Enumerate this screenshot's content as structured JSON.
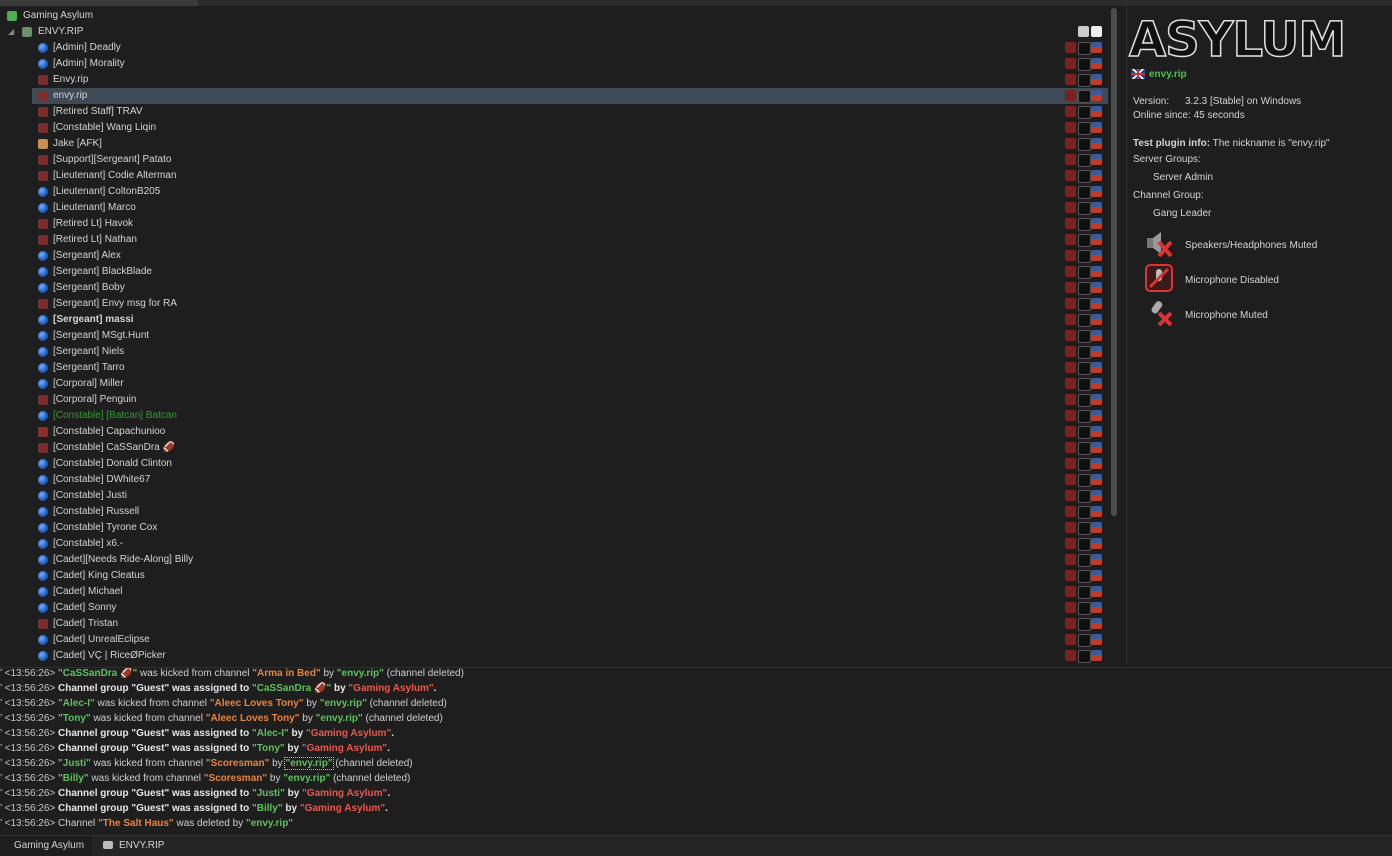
{
  "tree": {
    "server_name": "Gaming Asylum",
    "channel_name": "ENVY.RIP",
    "users": [
      {
        "name": "[Admin] Deadly",
        "kind": "blue"
      },
      {
        "name": "[Admin] Morality",
        "kind": "blue"
      },
      {
        "name": "Envy.rip",
        "kind": "dev"
      },
      {
        "name": "envy.rip",
        "kind": "dev",
        "selected": true
      },
      {
        "name": "[Retired Staff] TRAV",
        "kind": "dev"
      },
      {
        "name": "[Constable] Wang Liqin",
        "kind": "dev"
      },
      {
        "name": "Jake [AFK]",
        "kind": "away"
      },
      {
        "name": "[Support][Sergeant] Patato",
        "kind": "dev"
      },
      {
        "name": "[Lieutenant] Codie Alterman",
        "kind": "dev"
      },
      {
        "name": "[Lieutenant] ColtonB205",
        "kind": "blue"
      },
      {
        "name": "[Lieutenant] Marco",
        "kind": "blue"
      },
      {
        "name": "[Retired Lt] Havok",
        "kind": "dev"
      },
      {
        "name": "[Retired Lt] Nathan",
        "kind": "dev"
      },
      {
        "name": "[Sergeant] Alex",
        "kind": "blue"
      },
      {
        "name": "[Sergeant] BlackBlade",
        "kind": "blue"
      },
      {
        "name": "[Sergeant] Boby",
        "kind": "blue"
      },
      {
        "name": "[Sergeant] Envy msg for RA",
        "kind": "dev"
      },
      {
        "name": "[Sergeant] massi",
        "kind": "blue",
        "bold": true
      },
      {
        "name": "[Sergeant] MSgt.Hunt",
        "kind": "blue"
      },
      {
        "name": "[Sergeant] Niels",
        "kind": "blue"
      },
      {
        "name": "[Sergeant] Tarro",
        "kind": "blue"
      },
      {
        "name": "[Corporal] Miller",
        "kind": "blue"
      },
      {
        "name": "[Corporal] Penguin",
        "kind": "dev"
      },
      {
        "name": "[Constable] [Batcan] Batcan",
        "kind": "blue",
        "green": true
      },
      {
        "name": "[Constable] Capachunioo",
        "kind": "muted"
      },
      {
        "name": "[Constable] CaSSanDra 🏈",
        "kind": "dev"
      },
      {
        "name": "[Constable] Donald Clinton",
        "kind": "blue"
      },
      {
        "name": "[Constable] DWhite67",
        "kind": "blue"
      },
      {
        "name": "[Constable] Justi",
        "kind": "blue"
      },
      {
        "name": "[Constable] Russell",
        "kind": "blue"
      },
      {
        "name": "[Constable] Tyrone Cox",
        "kind": "blue"
      },
      {
        "name": "[Constable] x6.-",
        "kind": "blue"
      },
      {
        "name": "[Cadet][Needs Ride-Along] Billy",
        "kind": "blue"
      },
      {
        "name": "[Cadet] King Cleatus",
        "kind": "blue"
      },
      {
        "name": "[Cadet] Michael",
        "kind": "blue"
      },
      {
        "name": "[Cadet] Sonny",
        "kind": "blue"
      },
      {
        "name": "[Cadet] Tristan",
        "kind": "dev"
      },
      {
        "name": "[Cadet] UnrealEclipse",
        "kind": "blue"
      },
      {
        "name": "[Cadet] VÇ | RiceØPicker",
        "kind": "blue"
      }
    ]
  },
  "info": {
    "logo_text": "ASYLUM",
    "nickname": "envy.rip",
    "version_label": "Version:",
    "version_value": "3.2.3 [Stable] on Windows",
    "online_label": "Online since:",
    "online_value": "45 seconds",
    "test_plugin_label": "Test plugin info:",
    "test_plugin_text": "The nickname is \"envy.rip\"",
    "server_groups_label": "Server Groups:",
    "server_group": "Server Admin",
    "channel_group_label": "Channel Group:",
    "channel_group": "Gang Leader",
    "status": [
      {
        "label": "Speakers/Headphones Muted",
        "icon": "speakers-muted-icon"
      },
      {
        "label": "Microphone Disabled",
        "icon": "microphone-disabled-icon"
      },
      {
        "label": "Microphone Muted",
        "icon": "microphone-muted-icon"
      }
    ]
  },
  "log": {
    "lines": [
      {
        "ts": "<13:56:26>",
        "parts": [
          [
            "lgreen",
            "\"CaSSanDra 🏈\""
          ],
          [
            "plain",
            " was kicked from channel "
          ],
          [
            "orange",
            "\"Arma in Bed\""
          ],
          [
            "plain",
            " by "
          ],
          [
            "lgreen",
            "\"envy.rip\""
          ],
          [
            "plain",
            " (channel deleted)"
          ]
        ]
      },
      {
        "ts": "<13:56:26>",
        "parts": [
          [
            "w",
            "Channel group \"Guest\" was assigned to "
          ],
          [
            "lgreen",
            "\"CaSSanDra 🏈\""
          ],
          [
            "w",
            " by "
          ],
          [
            "lred",
            "\"Gaming Asylum\""
          ],
          [
            "w",
            "."
          ]
        ]
      },
      {
        "ts": "<13:56:26>",
        "parts": [
          [
            "lgreen",
            "\"Alec-I\""
          ],
          [
            "plain",
            " was kicked from channel "
          ],
          [
            "orange",
            "\"Aleec Loves Tony\""
          ],
          [
            "plain",
            " by "
          ],
          [
            "lgreen",
            "\"envy.rip\""
          ],
          [
            "plain",
            " (channel deleted)"
          ]
        ]
      },
      {
        "ts": "<13:56:26>",
        "parts": [
          [
            "lgreen",
            "\"Tony\""
          ],
          [
            "plain",
            " was kicked from channel "
          ],
          [
            "orange",
            "\"Aleec Loves Tony\""
          ],
          [
            "plain",
            " by "
          ],
          [
            "lgreen",
            "\"envy.rip\""
          ],
          [
            "plain",
            " (channel deleted)"
          ]
        ]
      },
      {
        "ts": "<13:56:26>",
        "parts": [
          [
            "w",
            "Channel group \"Guest\" was assigned to "
          ],
          [
            "lgreen",
            "\"Alec-I\""
          ],
          [
            "w",
            " by "
          ],
          [
            "lred",
            "\"Gaming Asylum\""
          ],
          [
            "w",
            "."
          ]
        ]
      },
      {
        "ts": "<13:56:26>",
        "parts": [
          [
            "w",
            "Channel group \"Guest\" was assigned to "
          ],
          [
            "lgreen",
            "\"Tony\""
          ],
          [
            "w",
            " by "
          ],
          [
            "lred",
            "\"Gaming Asylum\""
          ],
          [
            "w",
            "."
          ]
        ]
      },
      {
        "ts": "<13:56:26>",
        "parts": [
          [
            "lgreen",
            "\"Justi\""
          ],
          [
            "plain",
            " was kicked from channel "
          ],
          [
            "orange",
            "\"Scoresman\""
          ],
          [
            "plain",
            " by "
          ],
          [
            "lgreen focus",
            "\"envy.rip\""
          ],
          [
            "plain",
            " (channel deleted)"
          ]
        ]
      },
      {
        "ts": "<13:56:26>",
        "parts": [
          [
            "lgreen",
            "\"Billy\""
          ],
          [
            "plain",
            " was kicked from channel "
          ],
          [
            "orange",
            "\"Scoresman\""
          ],
          [
            "plain",
            " by "
          ],
          [
            "lgreen",
            "\"envy.rip\""
          ],
          [
            "plain",
            " (channel deleted)"
          ]
        ]
      },
      {
        "ts": "<13:56:26>",
        "parts": [
          [
            "w",
            "Channel group \"Guest\" was assigned to "
          ],
          [
            "lgreen",
            "\"Justi\""
          ],
          [
            "w",
            " by "
          ],
          [
            "lred",
            "\"Gaming Asylum\""
          ],
          [
            "w",
            "."
          ]
        ]
      },
      {
        "ts": "<13:56:26>",
        "parts": [
          [
            "w",
            "Channel group \"Guest\" was assigned to "
          ],
          [
            "lgreen",
            "\"Billy\""
          ],
          [
            "w",
            " by "
          ],
          [
            "lred",
            "\"Gaming Asylum\""
          ],
          [
            "w",
            "."
          ]
        ]
      },
      {
        "ts": "<13:56:26>",
        "parts": [
          [
            "plain",
            "Channel "
          ],
          [
            "orange",
            "\"The Salt Haus\""
          ],
          [
            "plain",
            " was deleted by "
          ],
          [
            "lgreen",
            "\"envy.rip\""
          ]
        ]
      }
    ]
  },
  "tabs": [
    {
      "label": "Gaming Asylum",
      "active": true
    },
    {
      "label": "ENVY.RIP",
      "active": false
    }
  ]
}
